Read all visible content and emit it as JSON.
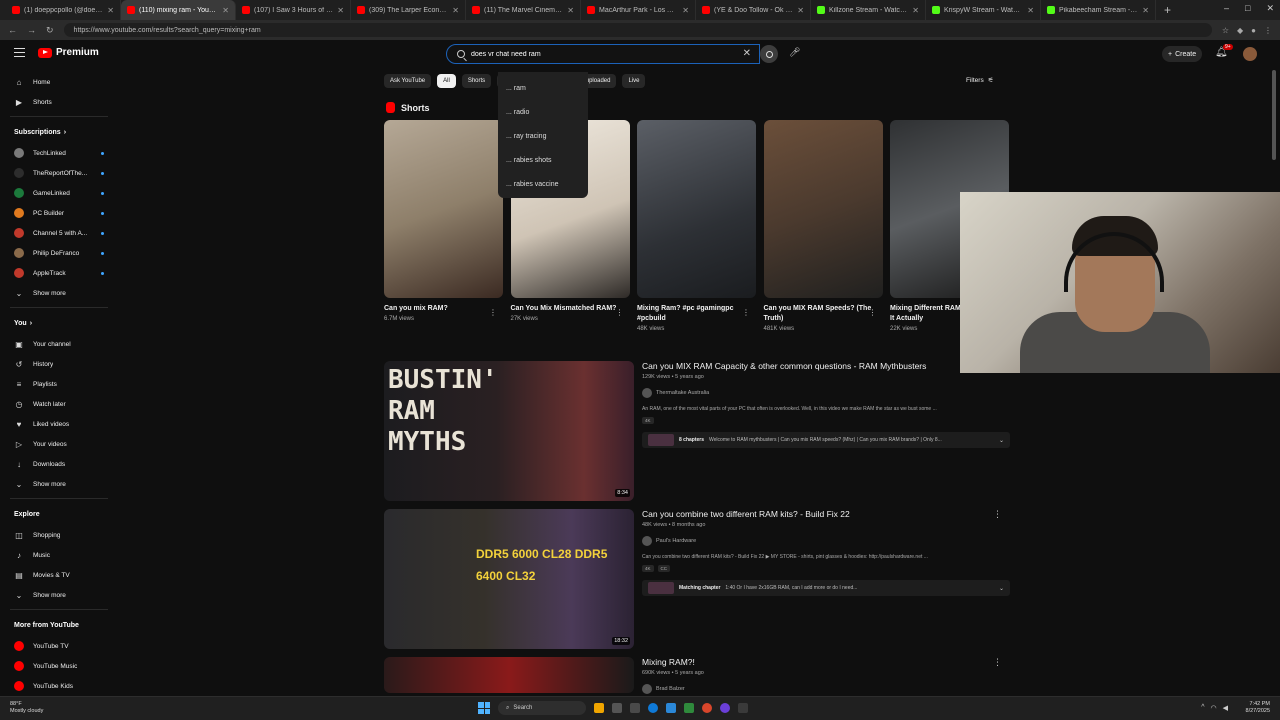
{
  "browser": {
    "tabs": [
      {
        "title": "(1) doeppcpollo (@doeppcpollo) / X",
        "fav": "red",
        "active": false
      },
      {
        "title": "(110) mixing ram - YouTube",
        "fav": "red",
        "active": true
      },
      {
        "title": "(107) I Saw 3 Hours of GTA 6 at 4k",
        "fav": "red",
        "active": false
      },
      {
        "title": "(309) The Larper Economy - You",
        "fav": "red",
        "active": false
      },
      {
        "title": "(11) The Marvel Cinematic Uni",
        "fav": "red",
        "active": false
      },
      {
        "title": "MacArthur Park - Los Angeles, C",
        "fav": "red",
        "active": false
      },
      {
        "title": "(YE & Doo Tollow - Ok - Yo",
        "fav": "red",
        "active": false
      },
      {
        "title": "Killzone Stream - Watch Live",
        "fav": "green",
        "active": false
      },
      {
        "title": "KrispyW Stream - Watch Live",
        "fav": "green",
        "active": false
      },
      {
        "title": "Pikabeecham Stream - Watch",
        "fav": "green",
        "active": false
      }
    ],
    "url": "https://www.youtube.com/results?search_query=mixing+ram",
    "new_tab": "+",
    "win_controls": [
      "–",
      "□",
      "✕"
    ]
  },
  "youtube": {
    "logo_text": "Premium",
    "search_value": "does vr chat need ram",
    "create_label": "Create",
    "notif_count": "9+",
    "chips": [
      "Ask YouTube",
      "All",
      "Shorts",
      "d",
      "Videos",
      "Recently uploaded",
      "Live"
    ],
    "filters_label": "Filters",
    "suggestions": [
      "... ram",
      "... radio",
      "... ray tracing",
      "... rabies shots",
      "... rabies vaccine"
    ]
  },
  "sidebar": {
    "main": [
      {
        "label": "Home",
        "icon": "⌂"
      },
      {
        "label": "Shorts",
        "icon": "▶"
      }
    ],
    "subscriptions_label": "Subscriptions",
    "subscriptions": [
      {
        "label": "TechLinked",
        "color": "#7a7a7a"
      },
      {
        "label": "TheReportOfThe...",
        "color": "#2d2d2d"
      },
      {
        "label": "GameLinked",
        "color": "#1c7a3c"
      },
      {
        "label": "PC Builder",
        "color": "#e07a1f"
      },
      {
        "label": "Channel 5 with A...",
        "color": "#c0392b"
      },
      {
        "label": "Philip DeFranco",
        "color": "#8a6a4a"
      },
      {
        "label": "AppleTrack",
        "color": "#c0392b"
      }
    ],
    "show_more": "Show more",
    "you_label": "You",
    "you_items": [
      {
        "label": "Your channel",
        "icon": "▣"
      },
      {
        "label": "History",
        "icon": "↺"
      },
      {
        "label": "Playlists",
        "icon": "≡"
      },
      {
        "label": "Watch later",
        "icon": "◷"
      },
      {
        "label": "Liked videos",
        "icon": "♥"
      },
      {
        "label": "Your videos",
        "icon": "▷"
      },
      {
        "label": "Downloads",
        "icon": "↓"
      }
    ],
    "explore_label": "Explore",
    "explore_items": [
      {
        "label": "Shopping",
        "icon": "◫"
      },
      {
        "label": "Music",
        "icon": "♪"
      },
      {
        "label": "Movies & TV",
        "icon": "▤"
      }
    ],
    "more_from_label": "More from YouTube",
    "more_from_items": [
      {
        "label": "YouTube TV",
        "color": "#ff0000"
      },
      {
        "label": "YouTube Music",
        "color": "#ff0000"
      },
      {
        "label": "YouTube Kids",
        "color": "#ff0000"
      }
    ]
  },
  "shorts": {
    "heading": "Shorts",
    "items": [
      {
        "title": "Can you mix RAM?",
        "views": "6.7M views",
        "bg": "linear-gradient(160deg,#b5a896,#8e7f6a 50%,#3b2a22)"
      },
      {
        "title": "Can You Mix Mismatched RAM?",
        "views": "27K views",
        "bg": "linear-gradient(160deg,#efe9df,#cfc4b5 55%,#2e2a27)"
      },
      {
        "title": "Mixing Ram? #pc #gamingpc #pcbuild",
        "views": "48K views",
        "bg": "linear-gradient(160deg,#5b5f66,#2d3035 60%,#1a1c1f)"
      },
      {
        "title": "Can you MIX RAM Speeds? (The Truth)",
        "views": "481K views",
        "bg": "linear-gradient(160deg,#6b4f3a,#4b3a2e 50%,#20201f)"
      },
      {
        "title": "Mixing Different RAM Sticks, Does It Actually",
        "views": "22K views",
        "bg": "linear-gradient(160deg,#2f3133,#5a5d60 50%,#1a1a1a)"
      }
    ]
  },
  "videos": [
    {
      "title": "Can you MIX RAM Capacity & other common questions - RAM Mythbusters",
      "meta": "129K views • 5 years ago",
      "channel": "Thermaltake Australia",
      "desc": "An RAM, one of the most vital parts of your PC that often is overlooked. Well, in this video we make RAM the star as we bust some ...",
      "tags": [
        "4K"
      ],
      "chapters_bold": "8 chapters",
      "chapters_text": "Welcome to RAM mythbusters | Can you mix RAM speeds? (Mhz) | Can you mix RAM brands? | Only 8...",
      "duration": "8:34",
      "thumb_text": "BUSTIN' RAM MYTHS",
      "bg": "linear-gradient(90deg,#1c1c1f 0%,#2a2022 45%,#6a3030 80%,#3a1f2a 100%)"
    },
    {
      "title": "Can you combine two different RAM kits? - Build Fix 22",
      "meta": "48K views • 8 months ago",
      "channel": "Paul's Hardware",
      "desc": "Can you combine two different RAM kits? - Build Fix 22 ▶ MY STORE - shirts, pint glasses & hoodies: http://paulshardware.net ...",
      "tags": [
        "4K",
        "CC"
      ],
      "chapters_bold": "Matching chapter",
      "chapters_text": "1:40 Or I have 2x16GB RAM, can I add more or do I need...",
      "duration": "18:32",
      "thumb_text": "DDR5 6000 CL28  DDR5 6400 CL32",
      "bg": "linear-gradient(90deg,#2a2a2d 0%,#35312b 40%,#4b3a58 75%,#2b2233 100%)"
    },
    {
      "title": "Mixing RAM?!",
      "meta": "690K views • 5 years ago",
      "channel": "Brad Balzer",
      "duration": "",
      "bg": "linear-gradient(90deg,#2a1a1a,#8a1a1a 50%,#1a1a1a)"
    }
  ],
  "taskbar": {
    "weather_temp": "88°F",
    "weather_desc": "Mostly cloudy",
    "search_label": "Search",
    "time": "7:42 PM",
    "date": "8/27/2025"
  }
}
